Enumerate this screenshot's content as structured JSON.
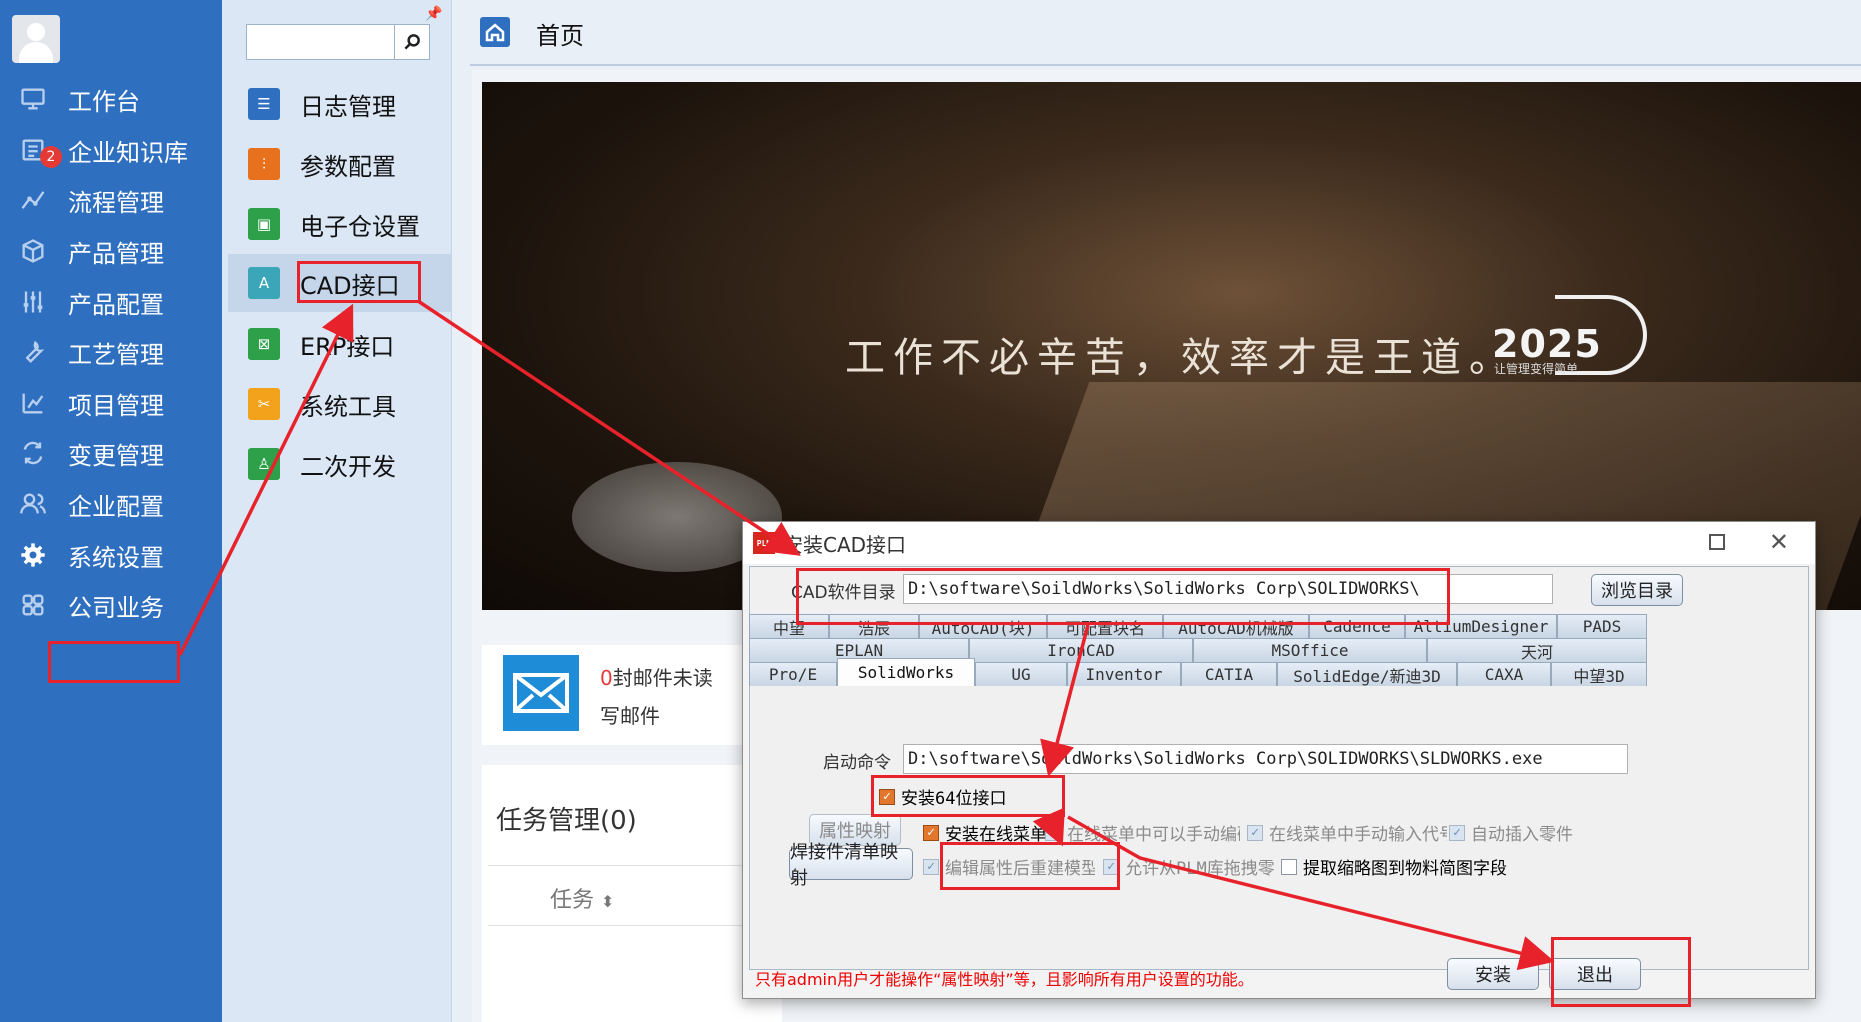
{
  "sidebar": {
    "items": [
      {
        "label": "工作台",
        "icon": "monitor-icon"
      },
      {
        "label": "企业知识库",
        "icon": "knowledge-icon",
        "badge": "2"
      },
      {
        "label": "流程管理",
        "icon": "flow-icon"
      },
      {
        "label": "产品管理",
        "icon": "box-icon"
      },
      {
        "label": "产品配置",
        "icon": "sliders-icon"
      },
      {
        "label": "工艺管理",
        "icon": "wrench-icon"
      },
      {
        "label": "项目管理",
        "icon": "chart-icon"
      },
      {
        "label": "变更管理",
        "icon": "change-icon"
      },
      {
        "label": "企业配置",
        "icon": "users-icon"
      },
      {
        "label": "系统设置",
        "icon": "gear-icon"
      },
      {
        "label": "公司业务",
        "icon": "grid-icon"
      }
    ]
  },
  "submenu": {
    "search_placeholder": "",
    "items": [
      {
        "label": "日志管理",
        "color": "#2f6fc0"
      },
      {
        "label": "参数配置",
        "color": "#e8711d"
      },
      {
        "label": "电子仓设置",
        "color": "#2fa04a"
      },
      {
        "label": "CAD接口",
        "color": "#3aa6b8"
      },
      {
        "label": "ERP接口",
        "color": "#2fa04a"
      },
      {
        "label": "系统工具",
        "color": "#f3a21c"
      },
      {
        "label": "二次开发",
        "color": "#2fa04a"
      }
    ]
  },
  "header": {
    "title": "首页"
  },
  "banner": {
    "slogan": "工作不必辛苦，效率才是王道。",
    "logo": "2025",
    "logo_sub": "让管理变得简单"
  },
  "mail": {
    "unread_count": "0",
    "unread_text": "封邮件未读",
    "write": "写邮件"
  },
  "tasks": {
    "title": "任务管理(0)",
    "column": "任务"
  },
  "dialog": {
    "title": "安装CAD接口",
    "plm_icon_text": "PLM",
    "cad_dir_label": "CAD软件目录",
    "cad_dir_value": "D:\\software\\SoildWorks\\SolidWorks Corp\\SOLIDWORKS\\",
    "browse": "浏览目录",
    "tabs_row1": [
      "中望",
      "浩辰",
      "AutoCAD(块)",
      "可配置块名",
      "AutoCAD机械版",
      "Cadence",
      "AltiumDesigner",
      "PADS"
    ],
    "tabs_row2": [
      "EPLAN",
      "IronCAD",
      "MSOffice",
      "天河"
    ],
    "tabs_row3": [
      "Pro/E",
      "SolidWorks",
      "UG",
      "Inventor",
      "CATIA",
      "SolidEdge/新迪3D",
      "CAXA",
      "中望3D"
    ],
    "start_cmd_label": "启动命令",
    "start_cmd_value": "D:\\software\\SoildWorks\\SolidWorks Corp\\SOLIDWORKS\\SLDWORKS.exe",
    "install64": "安装64位接口",
    "attr_map": "属性映射",
    "install_online": "安装在线菜单",
    "opt1": "在线菜单中可以手动编码",
    "opt2": "在线菜单中手动输入代号",
    "opt3": "自动插入零件",
    "weld_map": "焊接件清单映射",
    "opt4": "编辑属性后重建模型",
    "opt5": "允许从PLM库拖拽零件",
    "opt6": "提取缩略图到物料简图字段",
    "note": "只有admin用户才能操作“属性映射”等，且影响所有用户设置的功能。",
    "install": "安装",
    "exit": "退出"
  },
  "colors": {
    "sidebar_bg": "#2f6fc0",
    "highlight": "#e8222a",
    "checkbox_on": "#e2762c"
  }
}
